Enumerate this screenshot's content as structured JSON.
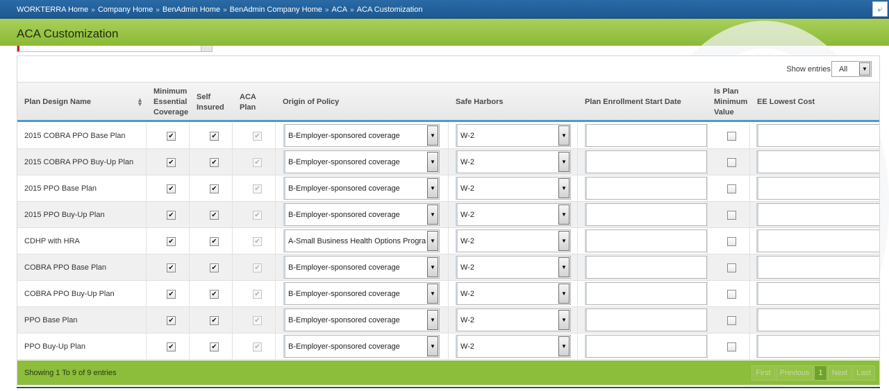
{
  "breadcrumb": [
    "WORKTERRA Home",
    "Company Home",
    "BenAdmin Home",
    "BenAdmin Company Home",
    "ACA",
    "ACA Customization"
  ],
  "breadcrumb_separator": "»",
  "page_title": "ACA Customization",
  "expand_icon": "expand-icon",
  "show_entries_label": "Show entries",
  "show_entries_value": "All",
  "columns": {
    "plan_design_name": "Plan Design Name",
    "mec_1": "Minimum",
    "mec_2": "Essential",
    "mec_3": "Coverage",
    "self_1": "Self",
    "self_2": "Insured",
    "aca_1": "ACA",
    "aca_2": "Plan",
    "origin": "Origin of Policy",
    "safe_harbors": "Safe Harbors",
    "enroll_start": "Plan Enrollment Start Date",
    "ipmv_1": "Is Plan",
    "ipmv_2": "Minimum",
    "ipmv_3": "Value",
    "ee_lowest": "EE Lowest Cost"
  },
  "rows": [
    {
      "name": "2015 COBRA PPO Base Plan",
      "mec": true,
      "self_insured": true,
      "aca_plan": true,
      "origin": "B-Employer-sponsored coverage",
      "safe_harbor": "W-2",
      "enroll_start": "",
      "is_min_value": false,
      "ee_lowest": ""
    },
    {
      "name": "2015 COBRA PPO Buy-Up Plan",
      "mec": true,
      "self_insured": true,
      "aca_plan": true,
      "origin": "B-Employer-sponsored coverage",
      "safe_harbor": "W-2",
      "enroll_start": "",
      "is_min_value": false,
      "ee_lowest": ""
    },
    {
      "name": "2015 PPO Base Plan",
      "mec": true,
      "self_insured": true,
      "aca_plan": true,
      "origin": "B-Employer-sponsored coverage",
      "safe_harbor": "W-2",
      "enroll_start": "",
      "is_min_value": false,
      "ee_lowest": ""
    },
    {
      "name": "2015 PPO Buy-Up Plan",
      "mec": true,
      "self_insured": true,
      "aca_plan": true,
      "origin": "B-Employer-sponsored coverage",
      "safe_harbor": "W-2",
      "enroll_start": "",
      "is_min_value": false,
      "ee_lowest": ""
    },
    {
      "name": "CDHP with HRA",
      "mec": true,
      "self_insured": true,
      "aca_plan": true,
      "origin": "A-Small Business Health Options Program",
      "safe_harbor": "W-2",
      "enroll_start": "",
      "is_min_value": false,
      "ee_lowest": ""
    },
    {
      "name": "COBRA PPO Base Plan",
      "mec": true,
      "self_insured": true,
      "aca_plan": true,
      "origin": "B-Employer-sponsored coverage",
      "safe_harbor": "W-2",
      "enroll_start": "",
      "is_min_value": false,
      "ee_lowest": ""
    },
    {
      "name": "COBRA PPO Buy-Up Plan",
      "mec": true,
      "self_insured": true,
      "aca_plan": true,
      "origin": "B-Employer-sponsored coverage",
      "safe_harbor": "W-2",
      "enroll_start": "",
      "is_min_value": false,
      "ee_lowest": ""
    },
    {
      "name": "PPO Base Plan",
      "mec": true,
      "self_insured": true,
      "aca_plan": true,
      "origin": "B-Employer-sponsored coverage",
      "safe_harbor": "W-2",
      "enroll_start": "",
      "is_min_value": false,
      "ee_lowest": ""
    },
    {
      "name": "PPO Buy-Up Plan",
      "mec": true,
      "self_insured": true,
      "aca_plan": true,
      "origin": "B-Employer-sponsored coverage",
      "safe_harbor": "W-2",
      "enroll_start": "",
      "is_min_value": false,
      "ee_lowest": ""
    }
  ],
  "footer_info": "Showing 1 To 9 of 9 entries",
  "pager": {
    "first": "First",
    "previous": "Previous",
    "current": "1",
    "next": "Next",
    "last": "Last"
  },
  "colors": {
    "topbar": "#1d5891",
    "title_bar": "#8bba36",
    "header_accent": "#4a9ad8",
    "footer": "#8cbd3b"
  }
}
